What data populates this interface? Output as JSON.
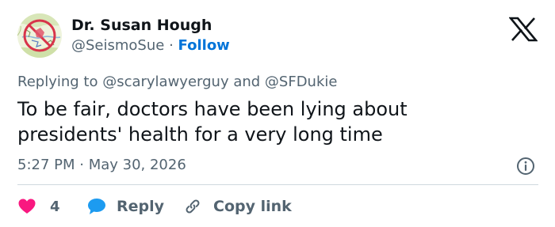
{
  "author": {
    "display_name": "Dr. Susan Hough",
    "handle": "@SeismoSue",
    "separator": "·",
    "follow_label": "Follow"
  },
  "reply_context": "Replying to @scarylawyerguy and @SFDukie",
  "tweet": {
    "text_line1": "To be fair, doctors have been lying about",
    "text_line2": "presidents' health for a very long time",
    "timestamp": "5:27 PM · May 30, 2026"
  },
  "actions": {
    "like_count": "4",
    "reply_label": "Reply",
    "copy_link_label": "Copy link"
  },
  "icons": {
    "brand": "x-logo-icon",
    "info": "info-icon",
    "like": "heart-icon",
    "reply": "speech-bubble-icon",
    "copy": "link-icon"
  },
  "colors": {
    "text_primary": "#0f1419",
    "text_secondary": "#536471",
    "link_blue": "#0074d9",
    "like_pink": "#f91880",
    "reply_blue": "#1d9bf0",
    "divider": "#cfd9de"
  }
}
